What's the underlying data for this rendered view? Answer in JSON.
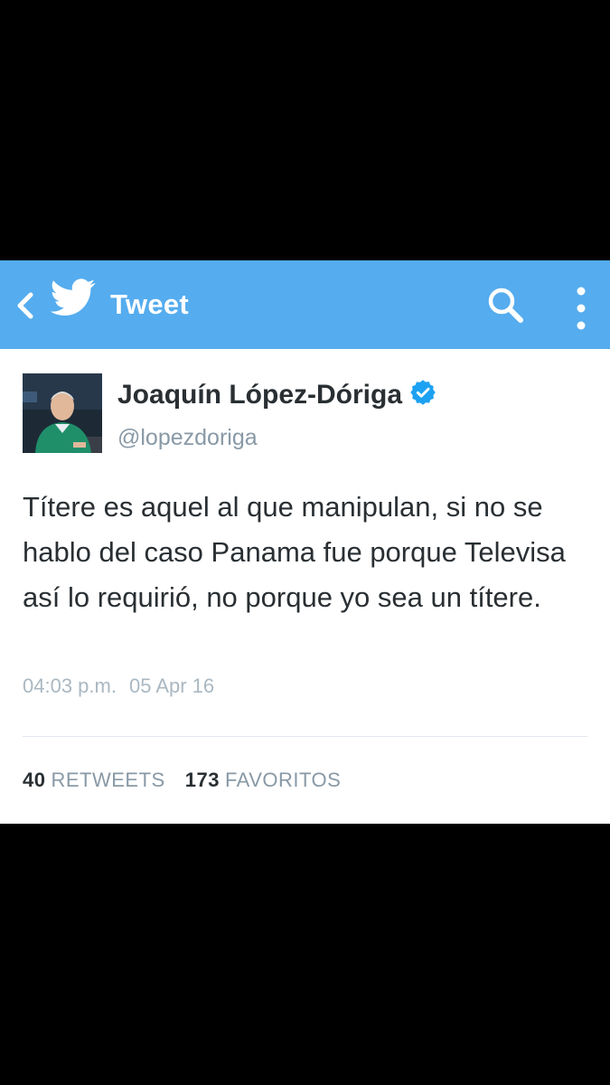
{
  "header": {
    "title": "Tweet",
    "back_icon": "chevron-left-icon",
    "logo_icon": "twitter-bird-icon",
    "search_icon": "search-icon",
    "menu_icon": "more-vertical-icon",
    "bg_color": "#55acee"
  },
  "tweet": {
    "author_name": "Joaquín López-Dóriga",
    "verified_icon": "verified-badge-icon",
    "handle": "@lopezdoriga",
    "text": "Títere es aquel al que manipulan, si no se hablo del caso Panama fue porque Televisa así lo requirió, no porque yo sea un títere.",
    "time": "04:03 p.m.",
    "date": "05 Apr 16",
    "retweets_count": "40",
    "retweets_label": "RETWEETS",
    "favorites_count": "173",
    "favorites_label": "FAVORITOS"
  }
}
